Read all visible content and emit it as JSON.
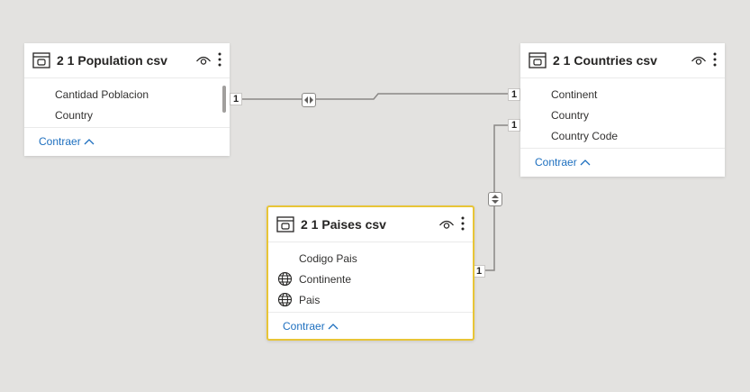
{
  "tables": {
    "population": {
      "title": "2 1 Population csv",
      "fields": [
        "Cantidad Poblacion",
        "Country"
      ],
      "collapse_label": "Contraer"
    },
    "countries": {
      "title": "2 1 Countries csv",
      "fields": [
        "Continent",
        "Country",
        "Country Code"
      ],
      "collapse_label": "Contraer"
    },
    "paises": {
      "title": "2 1 Paises csv",
      "fields": [
        "Codigo Pais",
        "Continente",
        "Pais"
      ],
      "collapse_label": "Contraer"
    }
  },
  "relationships": [
    {
      "from_table": "2 1 Population csv",
      "to_table": "2 1 Countries csv",
      "from_cardinality": "1",
      "to_cardinality": "1",
      "cross_filter": "both"
    },
    {
      "from_table": "2 1 Paises csv",
      "to_table": "2 1 Countries csv",
      "from_cardinality": "1",
      "to_cardinality": "1",
      "cross_filter": "both"
    }
  ],
  "colors": {
    "canvas": "#e3e2e0",
    "selected_border": "#e8c537",
    "link": "#1d6fbf",
    "line": "#8a8886"
  }
}
